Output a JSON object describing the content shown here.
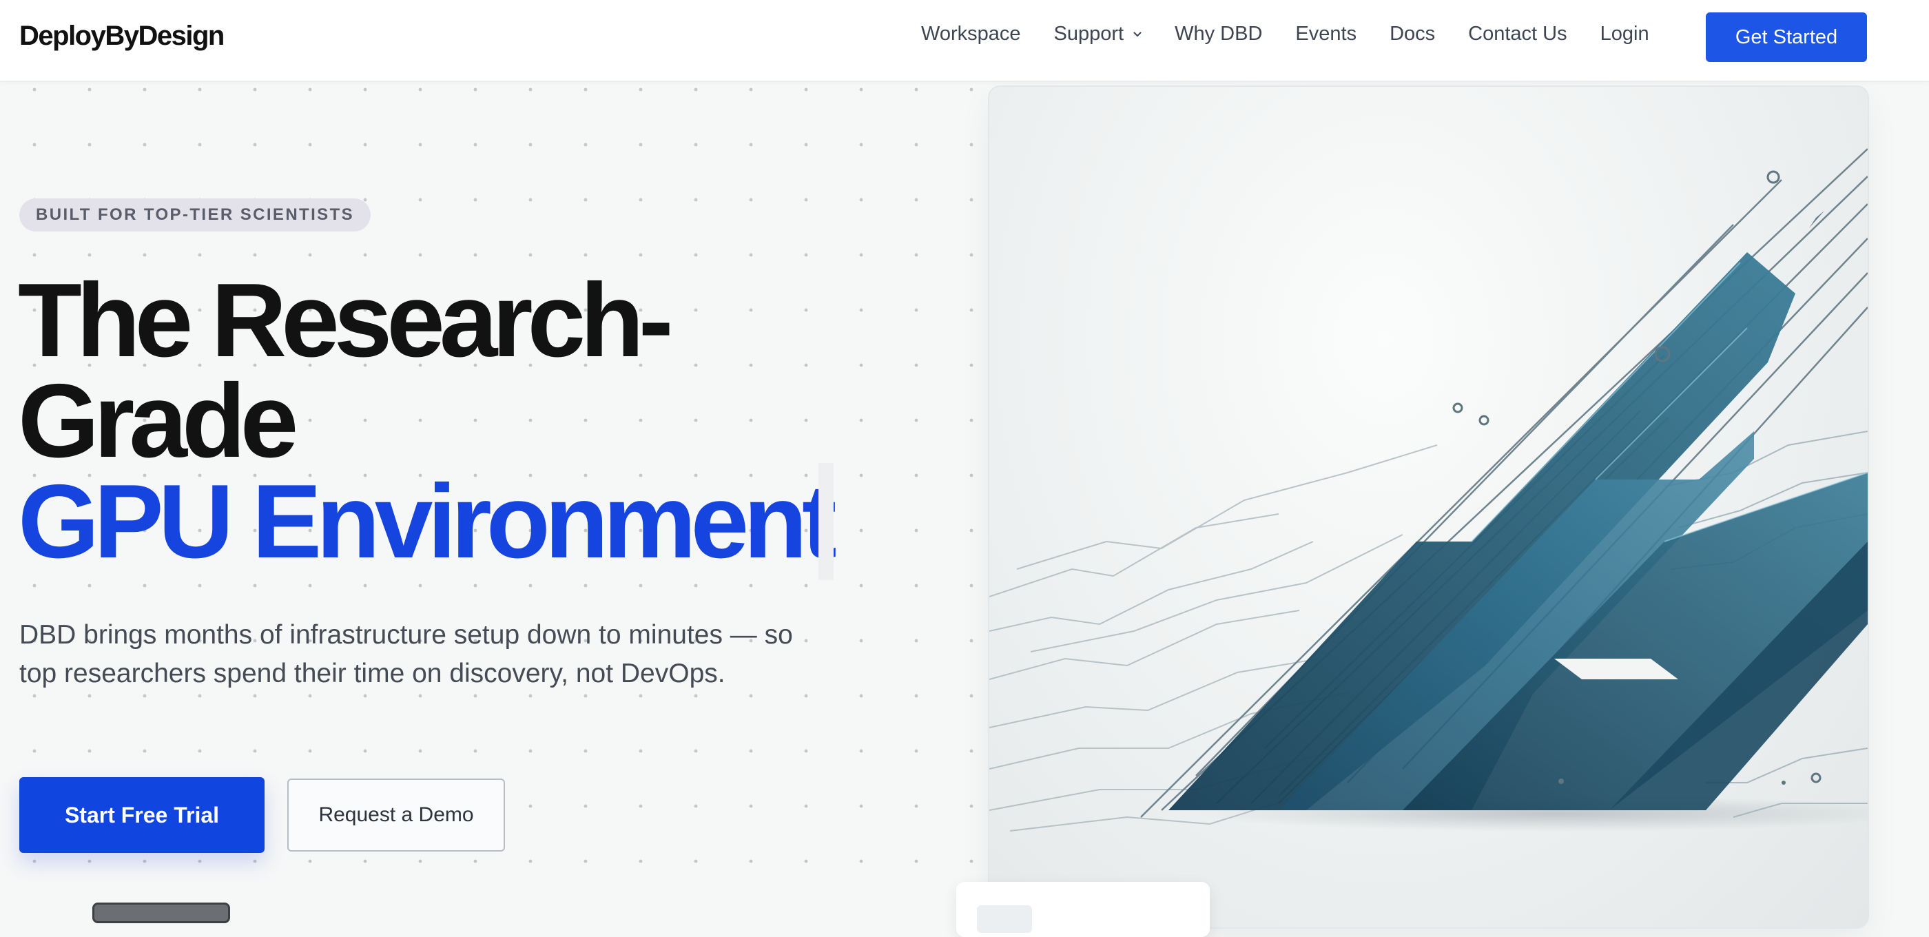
{
  "header": {
    "logo": "DeployByDesign",
    "nav": [
      {
        "label": "Workspace"
      },
      {
        "label": "Support",
        "has_dropdown": true
      },
      {
        "label": "Why DBD"
      },
      {
        "label": "Events"
      },
      {
        "label": "Docs"
      },
      {
        "label": "Contact Us"
      },
      {
        "label": "Login"
      }
    ],
    "cta_label": "Get Started"
  },
  "hero": {
    "badge": "BUILT FOR TOP-TIER SCIENTISTS",
    "headline_line1": "The Research-",
    "headline_line2": "Grade",
    "headline_line3": "GPU Environment",
    "subtitle": "DBD brings months of infrastructure setup down to minutes — so top researchers spend their time on discovery, not DevOps.",
    "primary_button": "Start Free Trial",
    "secondary_button": "Request a Demo"
  },
  "colors": {
    "accent": "#1d56e6",
    "headline_accent": "#1544df",
    "text": "#121212",
    "muted": "#454b54"
  },
  "icons": {
    "support_dropdown": "chevron-down-icon"
  }
}
